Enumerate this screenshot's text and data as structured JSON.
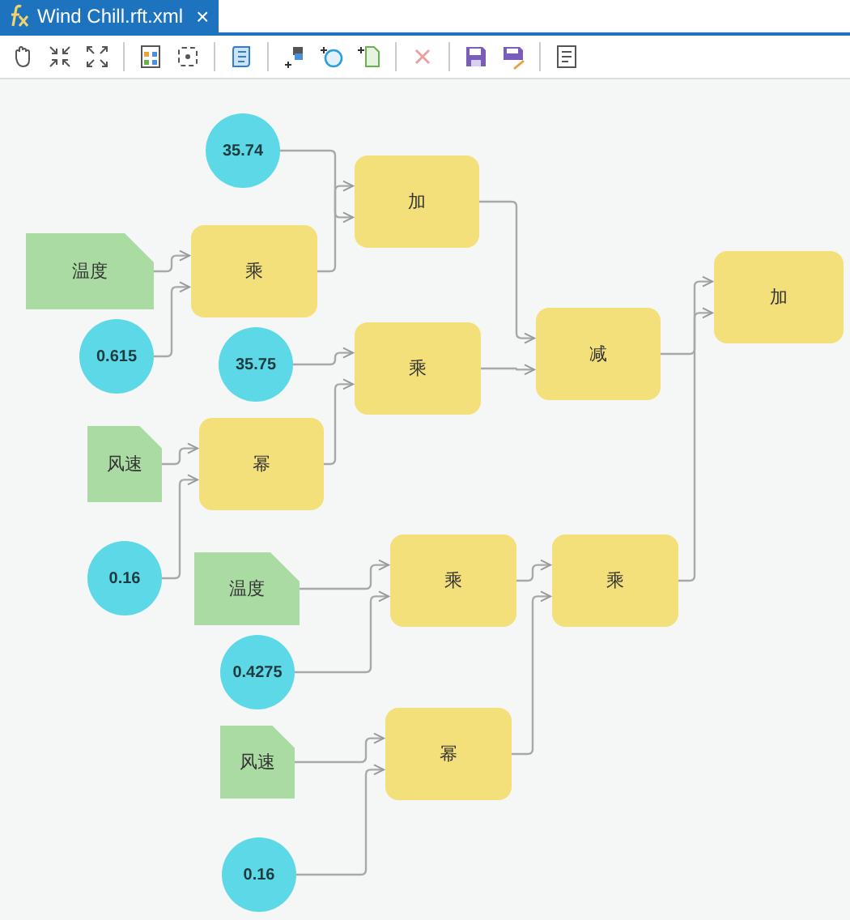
{
  "tabs": [
    {
      "label": "Wind Chill.rft.xml",
      "close": "×",
      "selected": true
    }
  ],
  "diagram": {
    "nodes": [
      {
        "kind": "constant",
        "label": "35.74"
      },
      {
        "kind": "function",
        "label": "加"
      },
      {
        "kind": "field",
        "label": "温度"
      },
      {
        "kind": "function",
        "label": "乘"
      },
      {
        "kind": "function",
        "label": "加"
      },
      {
        "kind": "constant",
        "label": "0.615"
      },
      {
        "kind": "constant",
        "label": "35.75"
      },
      {
        "kind": "function",
        "label": "乘"
      },
      {
        "kind": "function",
        "label": "减"
      },
      {
        "kind": "field",
        "label": "风速"
      },
      {
        "kind": "function",
        "label": "幂"
      },
      {
        "kind": "constant",
        "label": "0.16"
      },
      {
        "kind": "field",
        "label": "温度"
      },
      {
        "kind": "function",
        "label": "乘"
      },
      {
        "kind": "function",
        "label": "乘"
      },
      {
        "kind": "constant",
        "label": "0.4275"
      },
      {
        "kind": "field",
        "label": "风速"
      },
      {
        "kind": "function",
        "label": "幂"
      },
      {
        "kind": "constant",
        "label": "0.16"
      }
    ]
  }
}
